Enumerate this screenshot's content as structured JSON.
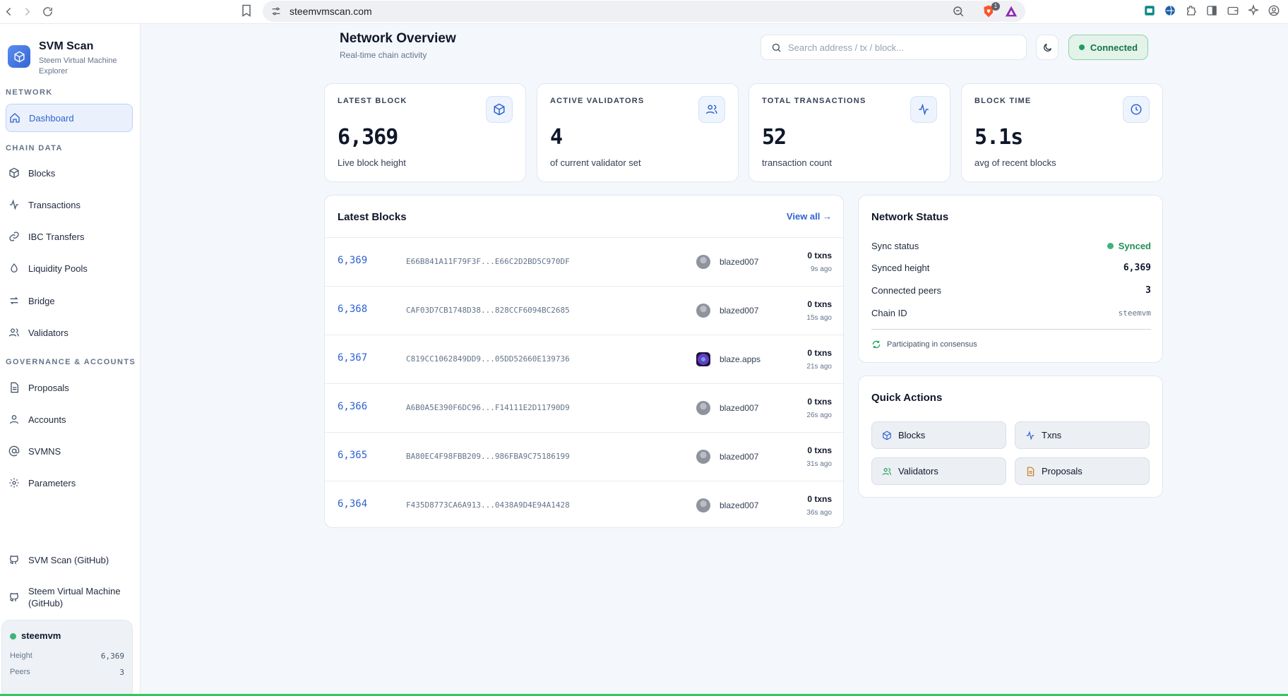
{
  "browser": {
    "url": "steemvmscan.com",
    "brave_badge": "1"
  },
  "sidebar": {
    "app_title": "SVM Scan",
    "app_subtitle": "Steem Virtual Machine Explorer",
    "sections": {
      "network": "NETWORK",
      "chain_data": "CHAIN DATA",
      "governance": "GOVERNANCE & ACCOUNTS"
    },
    "items": {
      "dashboard": "Dashboard",
      "blocks": "Blocks",
      "transactions": "Transactions",
      "ibc": "IBC Transfers",
      "pools": "Liquidity Pools",
      "bridge": "Bridge",
      "validators": "Validators",
      "proposals": "Proposals",
      "accounts": "Accounts",
      "svmns": "SVMNS",
      "parameters": "Parameters",
      "github_scan": "SVM Scan (GitHub)",
      "github_svm": "Steem Virtual Machine (GitHub)"
    },
    "network_card": {
      "name": "steemvm",
      "height_label": "Height",
      "height_value": "6,369",
      "peers_label": "Peers",
      "peers_value": "3"
    }
  },
  "header": {
    "title": "Network Overview",
    "subtitle": "Real-time chain activity",
    "search_placeholder": "Search address / tx / block...",
    "connection": "Connected"
  },
  "stats": [
    {
      "label": "LATEST BLOCK",
      "value": "6,369",
      "caption": "Live block height",
      "icon": "cube-icon"
    },
    {
      "label": "ACTIVE VALIDATORS",
      "value": "4",
      "caption": "of current validator set",
      "icon": "users-icon"
    },
    {
      "label": "TOTAL TRANSACTIONS",
      "value": "52",
      "caption": "transaction count",
      "icon": "activity-icon"
    },
    {
      "label": "BLOCK TIME",
      "value": "5.1s",
      "caption": "avg of recent blocks",
      "icon": "clock-icon"
    }
  ],
  "latest_blocks": {
    "title": "Latest Blocks",
    "view_all": "View all →",
    "rows": [
      {
        "height": "6,369",
        "hash": "E66B841A11F79F3F...E66C2D2BD5C970DF",
        "proposer": "blazed007",
        "txs": "0 txns",
        "age": "9s ago"
      },
      {
        "height": "6,368",
        "hash": "CAF03D7CB1748D38...828CCF6094BC2685",
        "proposer": "blazed007",
        "txs": "0 txns",
        "age": "15s ago"
      },
      {
        "height": "6,367",
        "hash": "C819CC1062849DD9...05DD52660E139736",
        "proposer": "blaze.apps",
        "txs": "0 txns",
        "age": "21s ago"
      },
      {
        "height": "6,366",
        "hash": "A6B0A5E390F6DC96...F14111E2D11790D9",
        "proposer": "blazed007",
        "txs": "0 txns",
        "age": "26s ago"
      },
      {
        "height": "6,365",
        "hash": "BA80EC4F98FBB209...986FBA9C75186199",
        "proposer": "blazed007",
        "txs": "0 txns",
        "age": "31s ago"
      },
      {
        "height": "6,364",
        "hash": "F435D8773CA6A913...0438A9D4E94A1428",
        "proposer": "blazed007",
        "txs": "0 txns",
        "age": "36s ago"
      }
    ]
  },
  "network_status": {
    "title": "Network Status",
    "sync_label": "Sync status",
    "sync_value": "Synced",
    "height_label": "Synced height",
    "height_value": "6,369",
    "peers_label": "Connected peers",
    "peers_value": "3",
    "chain_label": "Chain ID",
    "chain_value": "steemvm",
    "consensus": "Participating in consensus"
  },
  "quick_actions": {
    "title": "Quick Actions",
    "blocks": "Blocks",
    "txns": "Txns",
    "validators": "Validators",
    "proposals": "Proposals"
  },
  "colors": {
    "accent": "#2f62d0",
    "success": "#1f9d5d",
    "background": "#f4f7fb"
  }
}
